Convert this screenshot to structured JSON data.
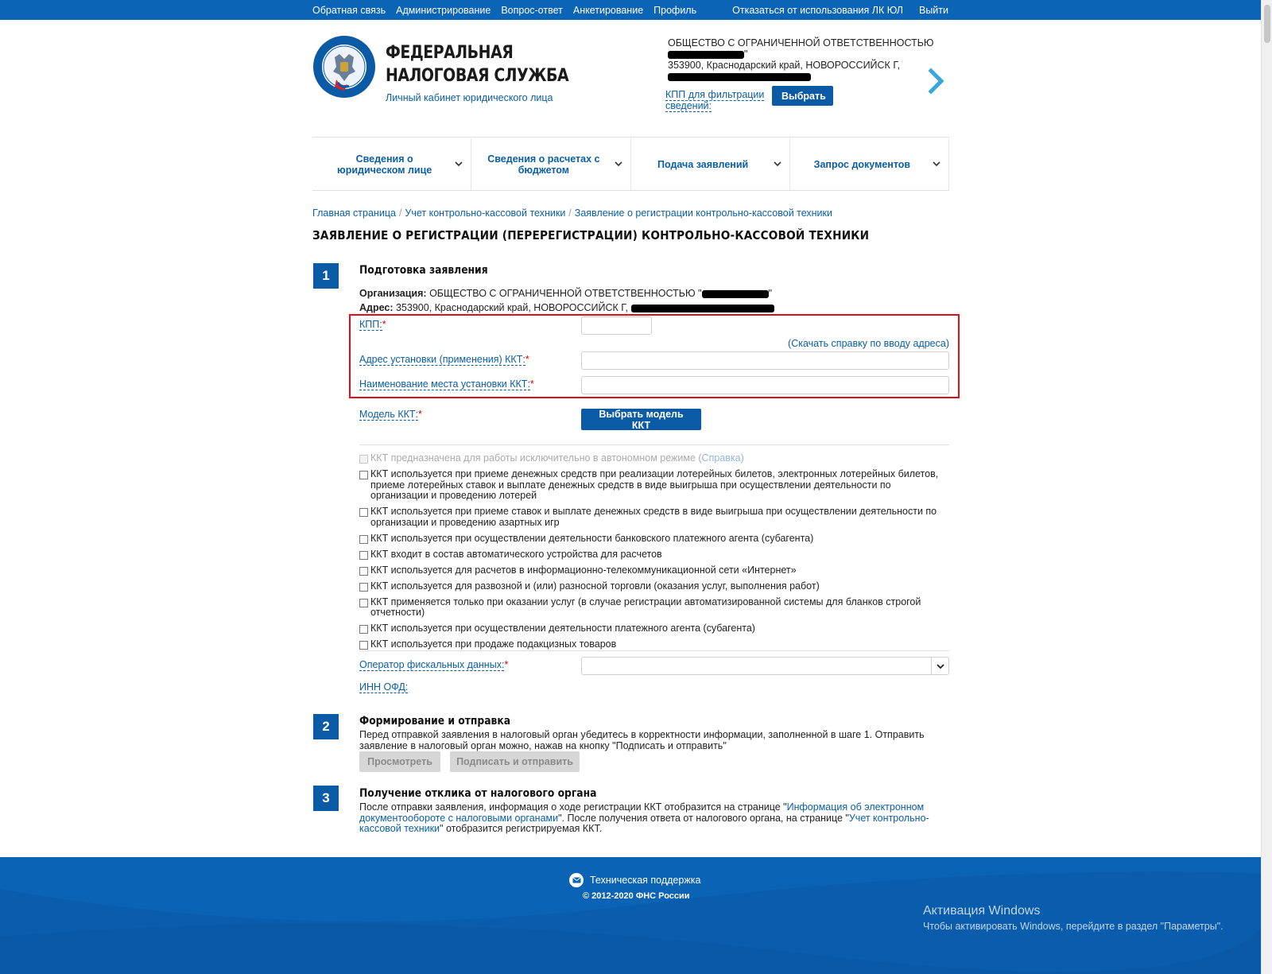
{
  "topbar": {
    "links": [
      "Обратная связь",
      "Администрирование",
      "Вопрос-ответ",
      "Анкетирование",
      "Профиль"
    ],
    "opt_out": "Отказаться от использования ЛК ЮЛ",
    "logout": "Выйти"
  },
  "header": {
    "title_line1": "ФЕДЕРАЛЬНАЯ",
    "title_line2": "НАЛОГОВАЯ СЛУЖБА",
    "subtitle": "Личный кабинет юридического лица",
    "org_line1": "ОБЩЕСТВО С ОГРАНИЧЕННОЙ ОТВЕТСТВЕННОСТЬЮ",
    "org_quote": "\"",
    "org_address": "353900, Краснодарский край, НОВОРОССИЙСК Г,",
    "kpp_filter": "КПП для фильтрации сведений:",
    "select_button": "Выбрать"
  },
  "nav": {
    "items": [
      "Сведения о юридическом лице",
      "Сведения о расчетах с бюджетом",
      "Подача заявлений",
      "Запрос документов"
    ]
  },
  "breadcrumb": {
    "items": [
      "Главная страница",
      "Учет контрольно-кассовой техники",
      "Заявление о регистрации контрольно-кассовой техники"
    ],
    "separator": "/"
  },
  "page_title": "ЗАЯВЛЕНИЕ О РЕГИСТРАЦИИ (ПЕРЕРЕГИСТРАЦИИ) КОНТРОЛЬНО-КАССОВОЙ ТЕХНИКИ",
  "step1": {
    "number": "1",
    "title": "Подготовка заявления",
    "org_label": "Организация:",
    "org_value": "ОБЩЕСТВО С ОГРАНИЧЕННОЙ ОТВЕТСТВЕННОСТЬЮ \"",
    "org_quote_end": "\"",
    "address_label": "Адрес:",
    "address_value": "353900, Краснодарский край, НОВОРОССИЙСК Г,",
    "kpp_label": "КПП:",
    "kpp_value": "",
    "help_link": "(Скачать справку по вводу адреса)",
    "install_address_label": "Адрес установки (применения) ККТ:",
    "install_address_value": "",
    "install_place_label": "Наименование места установки ККТ:",
    "install_place_value": "",
    "model_label": "Модель ККТ:",
    "model_button": "Выбрать модель ККТ",
    "required_mark": "*",
    "autonomous_text": "ККТ предназначена для работы исключительно в автономном режиме (",
    "autonomous_link": "Справка",
    "autonomous_close": ")",
    "checkboxes": [
      "ККТ используется при приеме денежных средств при реализации лотерейных билетов, электронных лотерейных билетов, приеме лотерейных ставок и выплате денежных средств в виде выигрыша при осуществлении деятельности по организации и проведению лотерей",
      "ККТ используется при приеме ставок и выплате денежных средств в виде выигрыша при осуществлении деятельности по организации и проведению азартных игр",
      "ККТ используется при осуществлении деятельности банковского платежного агента (субагента)",
      "ККТ входит в состав автоматического устройства для расчетов",
      "ККТ используется для расчетов в информационно-телекоммуникационной сети «Интернет»",
      "ККТ используется для развозной и (или) разносной торговли (оказания услуг, выполнения работ)",
      "ККТ применяется только при оказании услуг (в случае регистрации автоматизированной системы для бланков строгой отчетности)",
      "ККТ используется при осуществлении деятельности платежного агента (субагента)",
      "ККТ используется при продаже подакцизных товаров"
    ],
    "ofd_label": "Оператор фискальных данных:",
    "ofd_value": "",
    "inn_ofd_label": "ИНН ОФД:"
  },
  "step2": {
    "number": "2",
    "title": "Формирование и отправка",
    "text": "Перед отправкой заявления в налоговый орган убедитесь в корректности информации, заполненной в шаге 1. Отправить заявление в налоговый орган можно, нажав на кнопку \"Подписать и отправить\"",
    "preview_button": "Просмотреть",
    "sign_button": "Подписать и отправить"
  },
  "step3": {
    "number": "3",
    "title": "Получение отклика от налогового органа",
    "text_1": "После отправки заявления, информация о ходе регистрации ККТ отобразится на странице \"",
    "link_1": "Информация об электронном документообороте с налоговыми органами",
    "text_2": "\". После получения ответа от налогового органа, на странице \"",
    "link_2": "Учет контрольно-кассовой техники",
    "text_3": "\" отобразится регистрируемая ККТ."
  },
  "footer": {
    "support": "Техническая поддержка",
    "copyright": "© 2012-2020 ФНС России"
  },
  "activation": {
    "title": "Активация Windows",
    "text": "Чтобы активировать Windows, перейдите в раздел \"Параметры\"."
  },
  "colors": {
    "brand_blue": "#0b64b5",
    "link_blue": "#0a5ea8",
    "highlight_red": "#e10f1a"
  }
}
